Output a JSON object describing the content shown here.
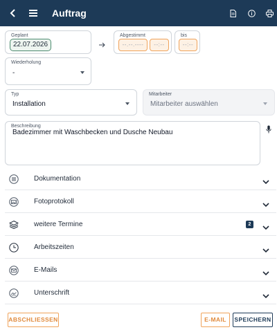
{
  "appbar": {
    "title": "Auftrag",
    "icons": [
      "back-arrow-icon",
      "menu-icon",
      "document-icon",
      "info-icon",
      "print-icon"
    ]
  },
  "geplant": {
    "label": "Geplant",
    "date": "22.07.2026"
  },
  "abgestimmt": {
    "label": "Abgestimmt",
    "date_placeholder": "--.--.----",
    "time_placeholder": "--:--"
  },
  "bis": {
    "label": "bis",
    "time_placeholder": "--:--"
  },
  "wiederholung": {
    "label": "Wiederholung",
    "value": "-"
  },
  "typ": {
    "label": "Typ",
    "value": "Installation"
  },
  "mitarbeiter": {
    "label": "Mitarbeiter",
    "placeholder": "Mitarbeiter auswählen"
  },
  "beschreibung": {
    "label": "Beschreibung",
    "value": "Badezimmer mit Waschbecken und Dusche  Neubau"
  },
  "sections": [
    {
      "label": "Dokumentation",
      "icon": "list-icon"
    },
    {
      "label": "Fotoprotokoll",
      "icon": "photo-icon"
    },
    {
      "label": "weitere Termine",
      "icon": "layers-icon",
      "badge": "2"
    },
    {
      "label": "Arbeitszeiten",
      "icon": "clock-icon"
    },
    {
      "label": "E-Mails",
      "icon": "mail-icon"
    },
    {
      "label": "Unterschrift",
      "icon": "signature-icon"
    }
  ],
  "buttons": {
    "abschliessen": "ABSCHLIESSEN",
    "email": "E-MAIL",
    "speichern": "SPEICHERN"
  },
  "colors": {
    "appbar": "#1d3a57",
    "accent_orange": "#f0a35a",
    "date_border": "#4b8a6e"
  }
}
